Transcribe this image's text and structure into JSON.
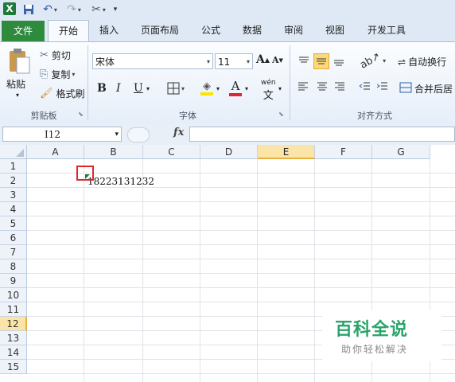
{
  "app": {
    "name_box_value": "I12",
    "active_tab": "开始"
  },
  "tabs": [
    {
      "label": "文件"
    },
    {
      "label": "开始"
    },
    {
      "label": "插入"
    },
    {
      "label": "页面布局"
    },
    {
      "label": "公式"
    },
    {
      "label": "数据"
    },
    {
      "label": "审阅"
    },
    {
      "label": "视图"
    },
    {
      "label": "开发工具"
    }
  ],
  "clipboard": {
    "paste": "粘贴",
    "cut": "剪切",
    "copy": "复制",
    "format_painter": "格式刷",
    "group_label": "剪贴板"
  },
  "font": {
    "family": "宋体",
    "size": "11",
    "bold": "B",
    "italic": "I",
    "underline": "U",
    "font_color_letter": "A",
    "phonetic": "wén",
    "group_label": "字体"
  },
  "alignment": {
    "wrap_text": "自动换行",
    "merge_center": "合并后居",
    "group_label": "对齐方式"
  },
  "formula_bar": {
    "fx": "fx",
    "formula": ""
  },
  "columns": [
    "A",
    "B",
    "C",
    "D",
    "E",
    "F",
    "G"
  ],
  "rows": [
    "1",
    "2",
    "3",
    "4",
    "5",
    "6",
    "7",
    "8",
    "9",
    "10",
    "11",
    "12",
    "13",
    "14",
    "15"
  ],
  "selected_column": "E",
  "selected_row": "12",
  "cells": {
    "B2": "18223131232"
  },
  "watermark": {
    "title": "百科全说",
    "subtitle": "助你轻松解决"
  },
  "colors": {
    "file_tab": "#2e8b3e",
    "selected_header": "#fbe4a8",
    "highlight_box": "#e0262b",
    "watermark_green": "#2aa36b"
  }
}
